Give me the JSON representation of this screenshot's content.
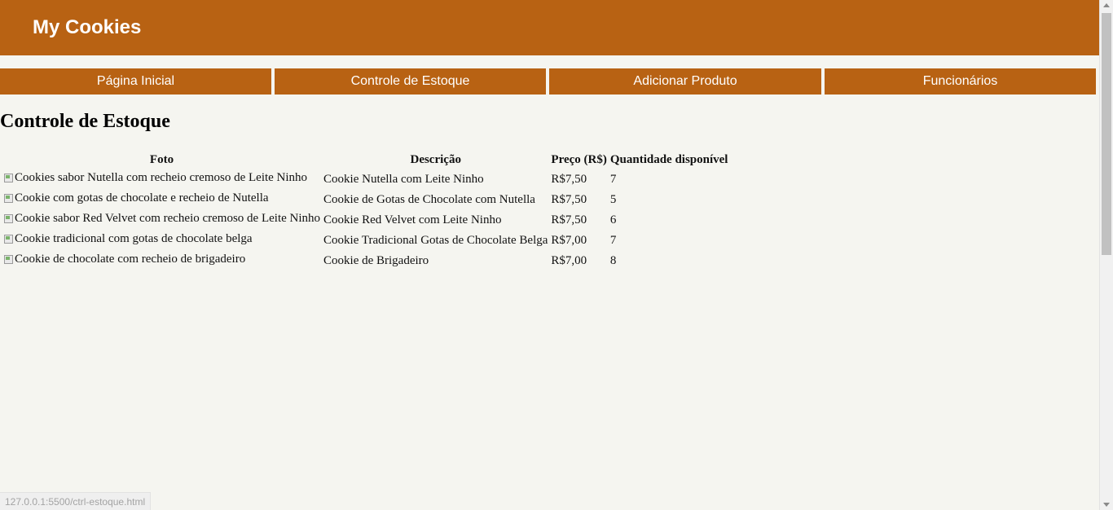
{
  "header": {
    "brand": "My Cookies"
  },
  "nav": {
    "items": [
      {
        "label": "Página Inicial"
      },
      {
        "label": "Controle de Estoque"
      },
      {
        "label": "Adicionar Produto"
      },
      {
        "label": "Funcionários"
      }
    ]
  },
  "page": {
    "title": "Controle de Estoque"
  },
  "table": {
    "headers": {
      "photo": "Foto",
      "description": "Descrição",
      "price": "Preço (R$)",
      "quantity": "Quantidade disponível"
    },
    "rows": [
      {
        "photo_alt": "Cookies sabor Nutella com recheio cremoso de Leite Ninho",
        "description": "Cookie Nutella com Leite Ninho",
        "price": "R$7,50",
        "quantity": "7"
      },
      {
        "photo_alt": "Cookie com gotas de chocolate e recheio de Nutella",
        "description": "Cookie de Gotas de Chocolate com Nutella",
        "price": "R$7,50",
        "quantity": "5"
      },
      {
        "photo_alt": "Cookie sabor Red Velvet com recheio cremoso de Leite Ninho",
        "description": "Cookie Red Velvet com Leite Ninho",
        "price": "R$7,50",
        "quantity": "6"
      },
      {
        "photo_alt": "Cookie tradicional com gotas de chocolate belga",
        "description": "Cookie Tradicional Gotas de Chocolate Belga",
        "price": "R$7,00",
        "quantity": "7"
      },
      {
        "photo_alt": "Cookie de chocolate com recheio de brigadeiro",
        "description": "Cookie de Brigadeiro",
        "price": "R$7,00",
        "quantity": "8"
      }
    ]
  },
  "status_bar": {
    "url": "127.0.0.1:5500/ctrl-estoque.html"
  },
  "colors": {
    "brand": "#b86213",
    "background": "#f5f5f0",
    "text_on_brand": "#ffffff"
  },
  "icons": {
    "broken_image": "broken-image-icon"
  }
}
